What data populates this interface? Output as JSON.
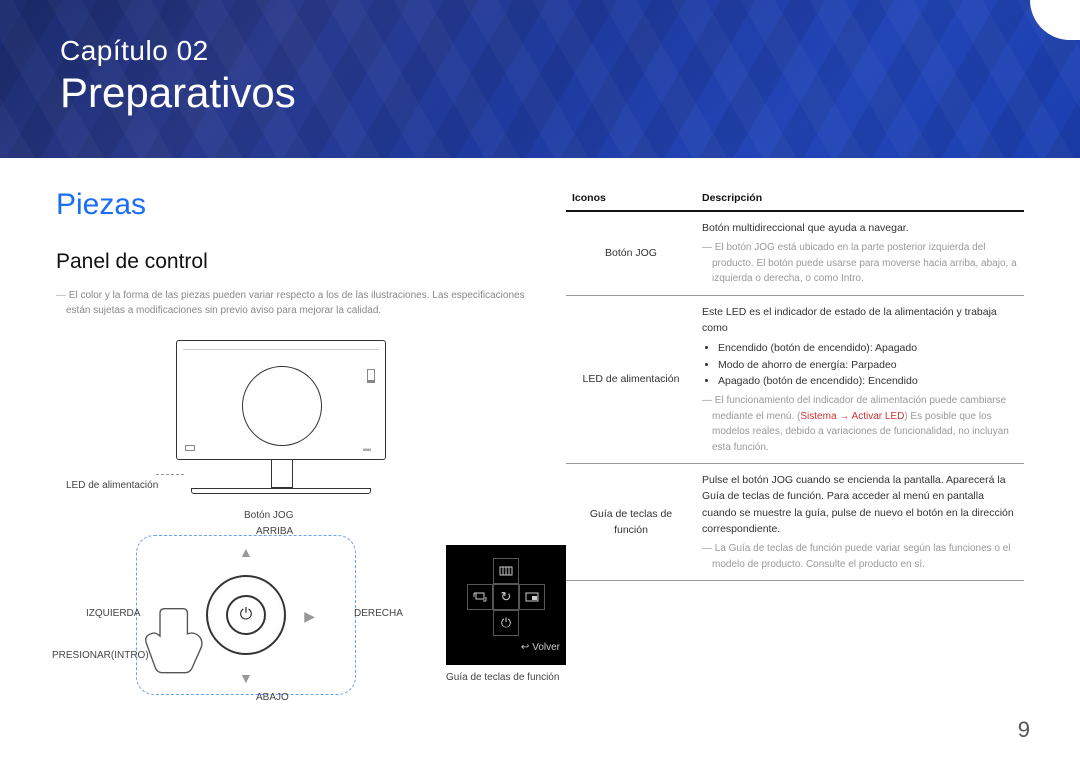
{
  "banner": {
    "chapter": "Capítulo 02",
    "title": "Preparativos"
  },
  "section": {
    "h1": "Piezas",
    "h2": "Panel de control",
    "note": "El color y la forma de las piezas pueden variar respecto a los de las ilustraciones. Las especificaciones están sujetas a modificaciones sin previo aviso para mejorar la calidad."
  },
  "diagram": {
    "power_led": "LED de alimentación",
    "jog_button": "Botón JOG",
    "up": "ARRIBA",
    "down": "ABAJO",
    "left": "IZQUIERDA",
    "right": "DERECHA",
    "press": "PRESIONAR(INTRO)",
    "guide_caption": "Guía de teclas de función",
    "guide_return": "Volver"
  },
  "table": {
    "head_icons": "Iconos",
    "head_desc": "Descripción",
    "rows": [
      {
        "icon": "Botón JOG",
        "main": "Botón multidireccional que ayuda a navegar.",
        "note": "El botón JOG está ubicado en la parte posterior izquierda del producto. El botón puede usarse para moverse hacia arriba, abajo, a izquierda o derecha, o como Intro."
      },
      {
        "icon": "LED de alimentación",
        "main": "Este LED es el indicador de estado de la alimentación y trabaja como",
        "bullets": [
          "Encendido (botón de encendido): Apagado",
          "Modo de ahorro de energía: Parpadeo",
          "Apagado (botón de encendido): Encendido"
        ],
        "note_pre": "El funcionamiento del indicador de alimentación puede cambiarse mediante el menú. (",
        "menu_a": "Sistema",
        "menu_b": "Activar LED",
        "note_post": ") Es posible que los modelos reales, debido a variaciones de funcionalidad, no incluyan esta función."
      },
      {
        "icon": "Guía de teclas de función",
        "main": "Pulse el botón JOG cuando se encienda la pantalla. Aparecerá la Guía de teclas de función. Para acceder al menú en pantalla cuando se muestre la guía, pulse de nuevo el botón en la dirección correspondiente.",
        "note": "La Guía de teclas de función puede variar según las funciones o el modelo de producto. Consulte el producto en sí."
      }
    ]
  },
  "page": "9"
}
